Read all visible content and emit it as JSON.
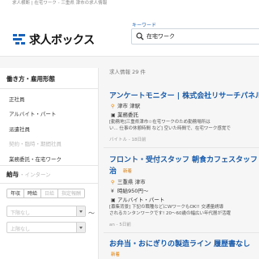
{
  "breadcrumb": "求人横断 | 在宅ワーク - 三重県 津市の求人情報",
  "logo": {
    "text": "求人ボックス"
  },
  "search": {
    "label": "キーワード",
    "value": "在宅ワーク"
  },
  "sidebar": {
    "section1_title": "働き方・雇用形態",
    "items": [
      "正社員",
      "アルバイト・パート",
      "派遣社員",
      "契約・臨時・期間社員",
      "業務委託・在宅ワーク",
      "新卒・インターン"
    ],
    "section2_title": "給与",
    "pay_tabs": [
      "年収",
      "時給",
      "日給",
      "指定報酬"
    ],
    "select_placeholder": "下限なし",
    "tilde": "〜",
    "select2_placeholder": "上限なし"
  },
  "results": {
    "count": "求人情報 29 件",
    "jobs": [
      {
        "title": "アンケートモニター | 株式会社リサーチパネル",
        "location": "津市 津駅",
        "type": "業務委託",
        "desc1": "[勤務地]三重県津市☆在宅ワークのため勤務場所は",
        "desc2": "い... 仕事の休憩時間 など] 空いた時間で、在宅ワーク感覚で",
        "footer": "バイトル - 18日前"
      },
      {
        "title": "フロント・受付スタッフ 朝食カフェスタッフ",
        "title_line2": "治",
        "new": "新着",
        "location": "三重県 津市",
        "pay": "時給950円〜",
        "type": "アルバイト・パート",
        "desc1": "[募集背景] 下記の職種などにWワークもOK!! 交通量誘導",
        "desc2": "されるカンタンワークです! 20〜60歳の幅広い年代層が活躍",
        "footer": "an - 5日前"
      },
      {
        "title": "お弁当・おにぎりの製造ライン 履歴書なし",
        "new": "新着"
      }
    ]
  },
  "colors": {
    "link": "#1a5aa8",
    "accent": "#e07b00",
    "brand": "#1a63b8"
  }
}
